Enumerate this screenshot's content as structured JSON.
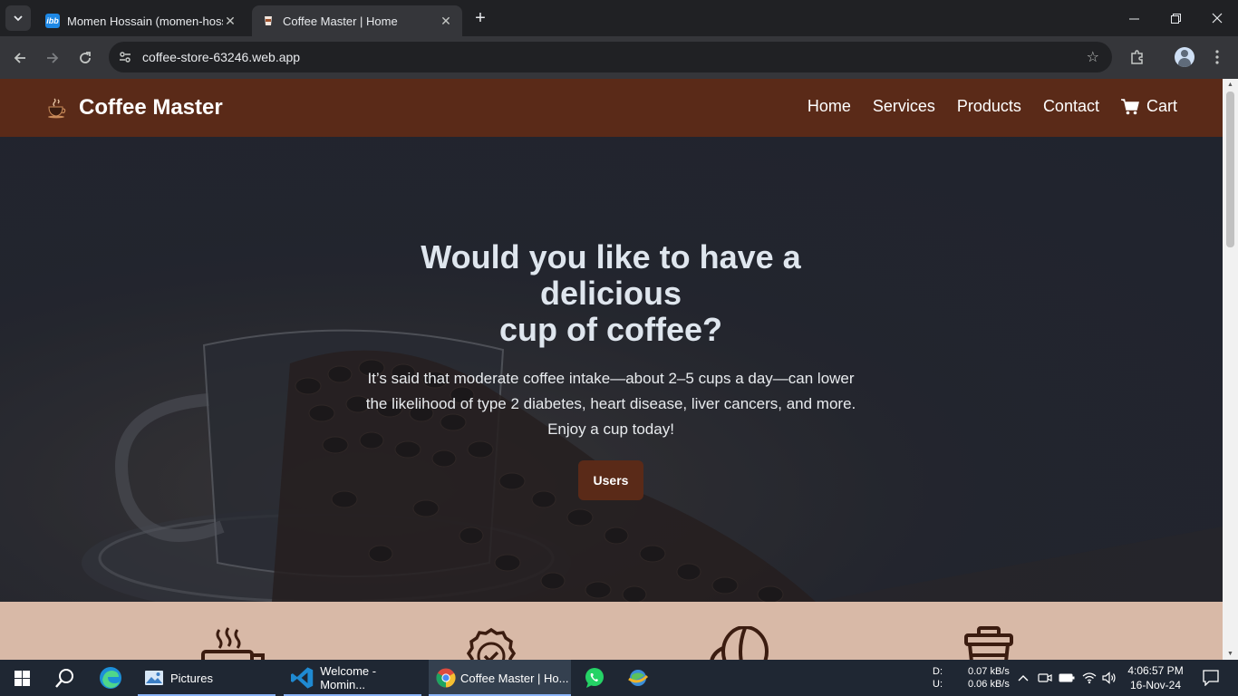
{
  "browser": {
    "tabs": [
      {
        "title": "Momen Hossain (momen-hossa",
        "favicon": "ibb",
        "active": false
      },
      {
        "title": "Coffee Master | Home",
        "favicon": "coffee-cup",
        "active": true
      }
    ],
    "url": "coffee-store-63246.web.app"
  },
  "site": {
    "brand": "Coffee Master",
    "menu": {
      "home": "Home",
      "services": "Services",
      "products": "Products",
      "contact": "Contact",
      "cart": "Cart"
    },
    "hero": {
      "title_line1": "Would you like to have a",
      "title_line2": "delicious",
      "title_line3": "cup of coffee?",
      "text_line1": "It’s said that moderate coffee intake—about 2–5 cups a day—can lower",
      "text_line2": "the likelihood of type 2 diabetes, heart disease, liver cancers, and more.",
      "text_line3": "Enjoy a cup today!",
      "button": "Users"
    },
    "colors": {
      "nav": "#5a2a18",
      "features_bg": "#d8b9a7",
      "hero_bg": "#232731"
    },
    "features": [
      "hot-coffee-icon",
      "quality-badge-icon",
      "coffee-bean-icon",
      "takeaway-cup-icon"
    ]
  },
  "taskbar": {
    "apps": [
      {
        "label": "Pictures",
        "icon": "photos-icon"
      },
      {
        "label": "Welcome - Momin...",
        "icon": "vscode-icon"
      },
      {
        "label": "Coffee Master | Ho...",
        "icon": "chrome-icon"
      }
    ],
    "net_down_label": "D:",
    "net_up_label": "U:",
    "net_down": "0.07 kB/s",
    "net_up": "0.06 kB/s",
    "time": "4:06:57 PM",
    "date": "16-Nov-24"
  }
}
